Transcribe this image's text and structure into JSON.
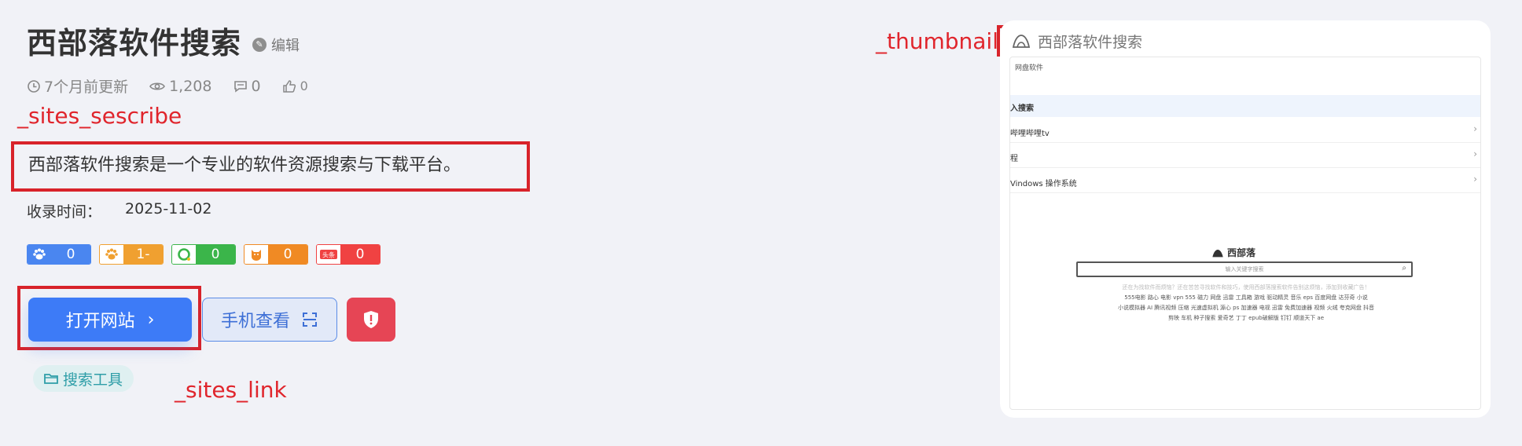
{
  "header": {
    "title": "西部落软件搜索",
    "edit_label": "编辑"
  },
  "meta": {
    "updated": "7个月前更新",
    "views": "1,208",
    "comments": "0",
    "likes": "0"
  },
  "annotations": {
    "describe": "_sites_sescribe",
    "thumbnail": "_thumbnail",
    "link": "_sites_link"
  },
  "description": "西部落软件搜索是一个专业的软件资源搜索与下载平台。",
  "collect": {
    "label": "收录时间：",
    "date": "2025-11-02"
  },
  "badges": [
    {
      "icon": "baidu-paw-icon",
      "value": "0",
      "color": "#4a86f0"
    },
    {
      "icon": "baidu-mobile-paw-icon",
      "value": "1-",
      "color": "#f0a030"
    },
    {
      "icon": "360-search-icon",
      "value": "0",
      "color": "#3bb54a"
    },
    {
      "icon": "sogou-icon",
      "value": "0",
      "color": "#f08a24"
    },
    {
      "icon": "toutiao-icon",
      "value": "0",
      "color": "#f04242"
    }
  ],
  "buttons": {
    "open_site": "打开网站",
    "mobile_view": "手机查看"
  },
  "tag": "搜索工具",
  "preview": {
    "site_name": "西部落软件搜索",
    "screenshot": {
      "tab": "网盘软件",
      "rows": [
        "入搜索",
        "哔哩哔哩tv",
        "程",
        "Vindows 操作系统"
      ],
      "brand": "西部落",
      "search_placeholder": "输入关键字搜索",
      "tip": "还在为找软件而烦恼？还在苦苦寻找软件和技巧，使用西部落搜索软件告别这烦恼，添加到收藏广告！",
      "links": [
        "555电影  路心  电影  vpn  555  磁力  网盘  迅雷  工具箱  游戏  驱动精灵  音乐  eps  百度网盘  达芬奇  小说",
        "小说模拟器  AI  腾讯视频  压缩  光速虚拟机  源心  ps  加速器  电视  迅雷  免费加速器  视频  火绒  夸克网盘  抖音",
        "剪映  车机  种子搜索  爱奇艺  丁丁  epub破解版  钉钉  顺道天下  ae"
      ]
    }
  }
}
